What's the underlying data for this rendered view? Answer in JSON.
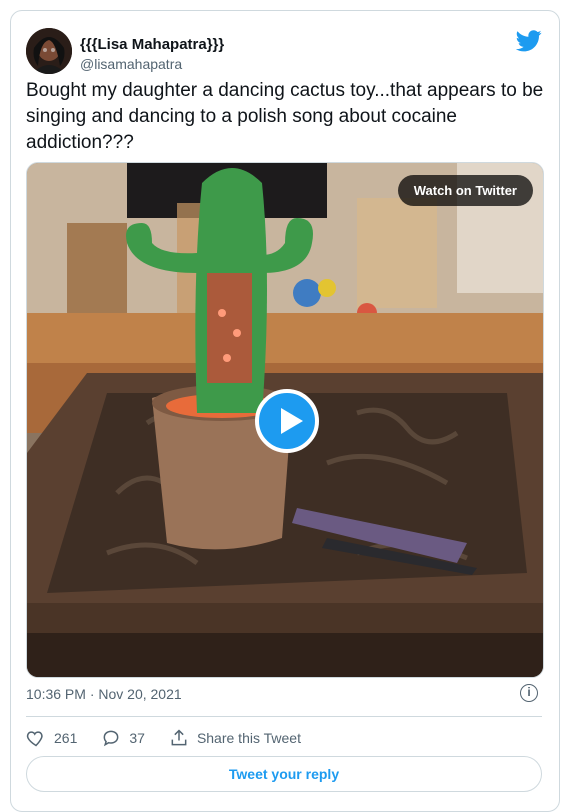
{
  "tweet": {
    "author_name": "{{{Lisa Mahapatra}}}",
    "author_handle": "@lisamahapatra",
    "text": "Bought my daughter a dancing cactus toy...that appears to be singing and dancing to a polish song about cocaine addiction???",
    "timestamp": "10:36 PM · Nov 20, 2021",
    "media": {
      "watch_label": "Watch on Twitter"
    },
    "actions": {
      "likes": "261",
      "replies": "37",
      "share_label": "Share this Tweet"
    },
    "reply_label": "Tweet your reply"
  },
  "colors": {
    "accent": "#1d9bf0",
    "secondary_text": "#536471",
    "border": "#cfd9de"
  },
  "icons": [
    "twitter-bird-icon",
    "play-icon",
    "info-icon",
    "heart-icon",
    "reply-icon",
    "share-icon"
  ]
}
